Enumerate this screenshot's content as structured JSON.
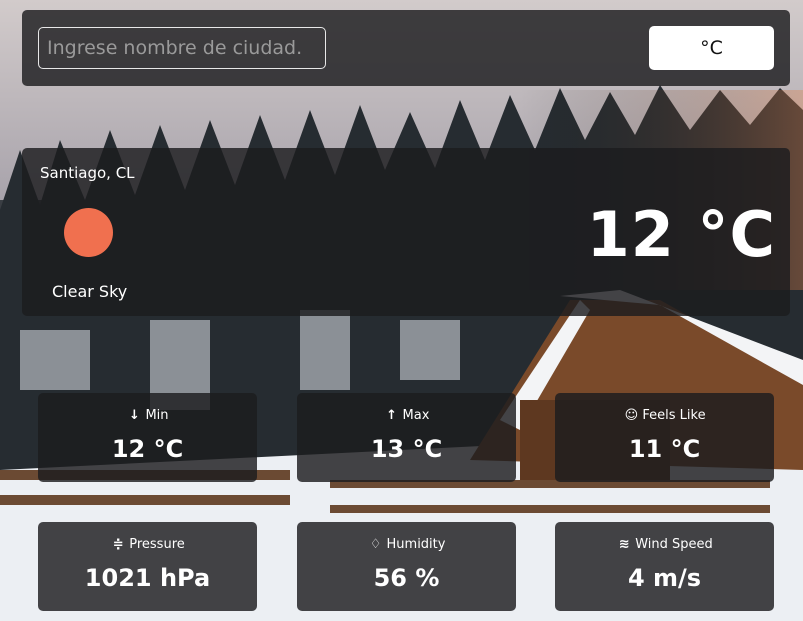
{
  "search": {
    "placeholder": "Ingrese nombre de ciudad."
  },
  "unit_toggle": {
    "label": "°C"
  },
  "current": {
    "location": "Santiago, CL",
    "condition": "Clear Sky",
    "temperature": "12 °C",
    "icon": "sun-icon",
    "icon_color": "#f0704f"
  },
  "stats": {
    "min": {
      "label": "Min",
      "value": "12 °C",
      "icon": "arrow-down-icon"
    },
    "max": {
      "label": "Max",
      "value": "13 °C",
      "icon": "arrow-up-icon"
    },
    "feels_like": {
      "label": "Feels Like",
      "value": "11 °C",
      "icon": "smiley-icon"
    },
    "pressure": {
      "label": "Pressure",
      "value": "1021 hPa",
      "icon": "pressure-icon"
    },
    "humidity": {
      "label": "Humidity",
      "value": "56 %",
      "icon": "droplet-icon"
    },
    "wind_speed": {
      "label": "Wind Speed",
      "value": "4 m/s",
      "icon": "wind-icon"
    }
  }
}
